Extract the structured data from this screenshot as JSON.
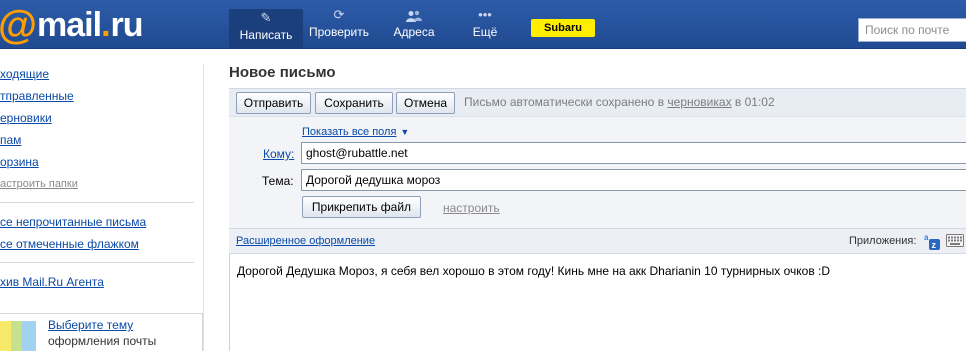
{
  "header": {
    "logo": {
      "at": "@",
      "mail": "mail",
      "dot": ".",
      "ru": "ru"
    },
    "nav": [
      {
        "label": "Написать",
        "icon": "pencil-icon"
      },
      {
        "label": "Проверить",
        "icon": "refresh-icon"
      },
      {
        "label": "Адреса",
        "icon": "contacts-icon"
      },
      {
        "label": "Ещё",
        "icon": "more-dots-icon"
      }
    ],
    "promo_label": "Subaru",
    "search_placeholder": "Поиск по почте"
  },
  "sidebar": {
    "folders": [
      "ходящие",
      "тправленные",
      "ерновики",
      "пам",
      "орзина"
    ],
    "folder_settings": "астроить папки",
    "filters": [
      "се непрочитанные письма",
      "се отмеченные флажком"
    ],
    "agent_archive": "хив Mail.Ru Агента",
    "theme": {
      "link": "Выберите тему",
      "subtitle": "оформления почты"
    }
  },
  "compose": {
    "title": "Новое письмо",
    "buttons": {
      "send": "Отправить",
      "save": "Сохранить",
      "cancel": "Отмена"
    },
    "autosave": {
      "prefix": "Письмо автоматически сохранено в ",
      "link": "черновиках",
      "suffix": " в 01:02"
    },
    "show_all_fields": "Показать все поля",
    "to_label": "Кому:",
    "to_value": "ghost@rubattle.net",
    "subject_label": "Тема:",
    "subject_value": "Дорогой дедушка мороз",
    "attach_button": "Прикрепить файл",
    "configure_link": "настроить",
    "rich_format": "Расширенное оформление",
    "apps_label": "Приложения:",
    "body": "Дорогой Дедушка Мороз, я себя вел хорошо в этом году! Кинь мне на акк Dharianin 10 турнирных очков :D"
  },
  "colors": {
    "header_bg": "#26509a",
    "link": "#0a4aa8",
    "promo_bg": "#ffee00",
    "logo_accent": "#ff9e00"
  }
}
